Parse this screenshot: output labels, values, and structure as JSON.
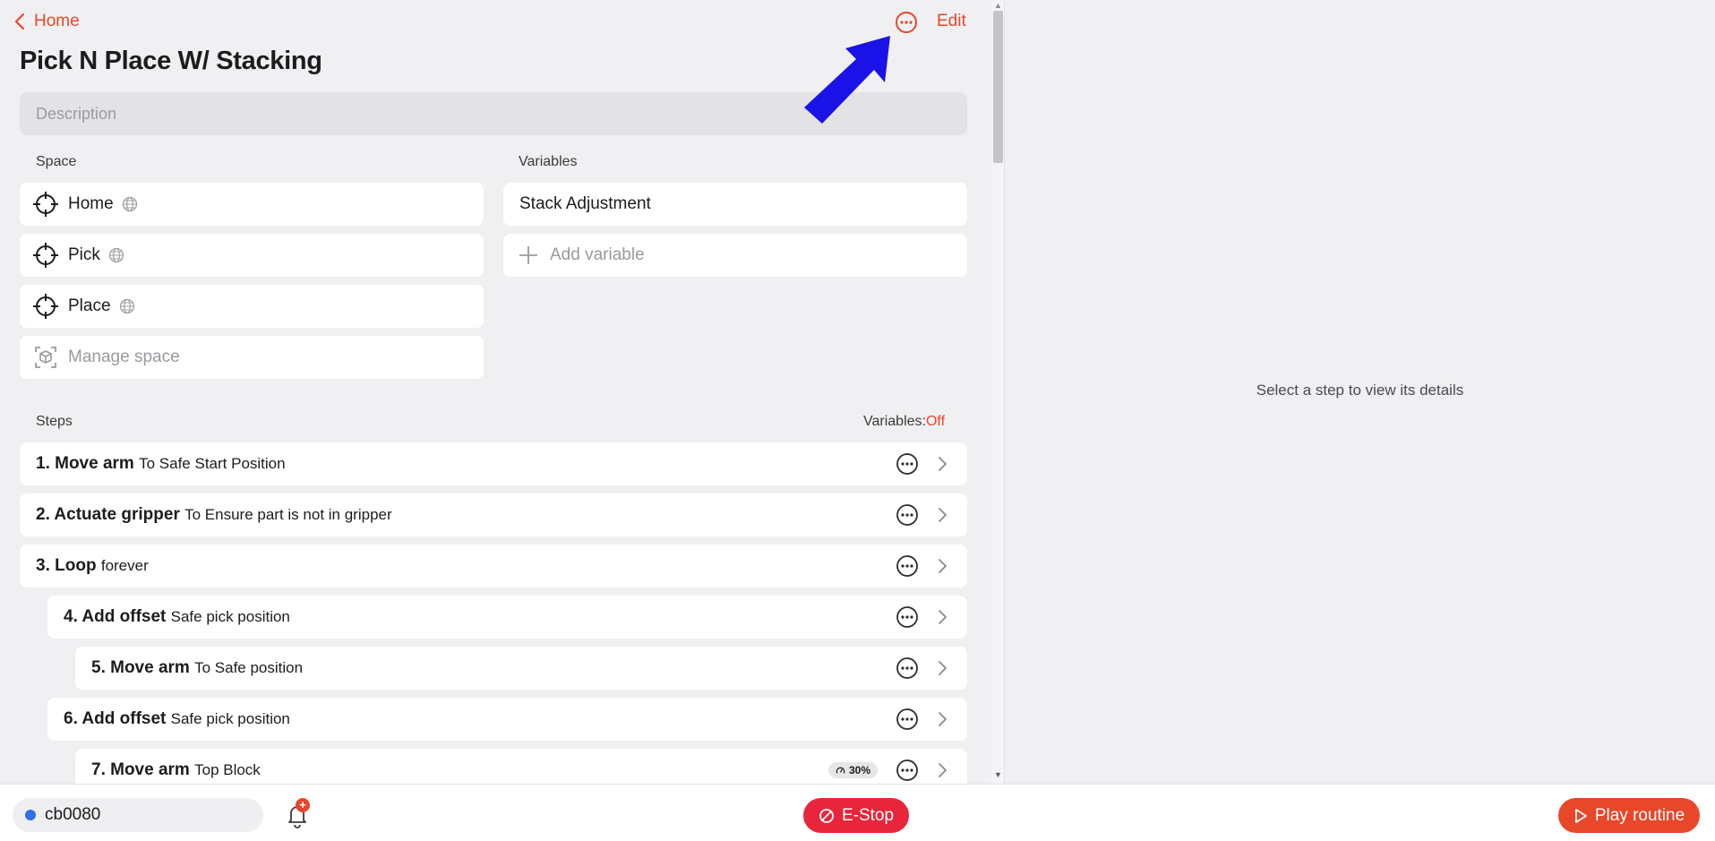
{
  "header": {
    "back_label": "Home",
    "edit_label": "Edit",
    "title": "Pick N Place W/ Stacking",
    "description_placeholder": "Description"
  },
  "space": {
    "label": "Space",
    "items": [
      {
        "label": "Home"
      },
      {
        "label": "Pick"
      },
      {
        "label": "Place"
      }
    ],
    "manage_label": "Manage space"
  },
  "variables": {
    "label": "Variables",
    "items": [
      {
        "label": "Stack Adjustment"
      }
    ],
    "add_label": "Add variable"
  },
  "steps": {
    "label": "Steps",
    "toggle_label": "Variables:",
    "toggle_value": "Off",
    "items": [
      {
        "title": "1. Move arm",
        "detail": "To Safe Start Position"
      },
      {
        "title": "2. Actuate gripper",
        "detail": "To Ensure part is not in gripper"
      },
      {
        "title": "3. Loop",
        "detail": "forever"
      },
      {
        "title": "4. Add offset",
        "detail": "Safe pick position"
      },
      {
        "title": "5. Move arm",
        "detail": " To Safe position"
      },
      {
        "title": "6. Add offset",
        "detail": "Safe pick position"
      },
      {
        "title": "7. Move arm",
        "detail": "Top Block",
        "badge": "30%"
      }
    ]
  },
  "details_panel": {
    "empty_message": "Select a step to view its details"
  },
  "bottom_bar": {
    "device_name": "cb0080",
    "notification_badge": "+",
    "estop_label": "E-Stop",
    "play_label": "Play routine"
  },
  "colors": {
    "accent": "#e8472a",
    "estop": "#e8253a",
    "device_status": "#2f6fe8",
    "annotation_arrow": "#1a12e6"
  }
}
